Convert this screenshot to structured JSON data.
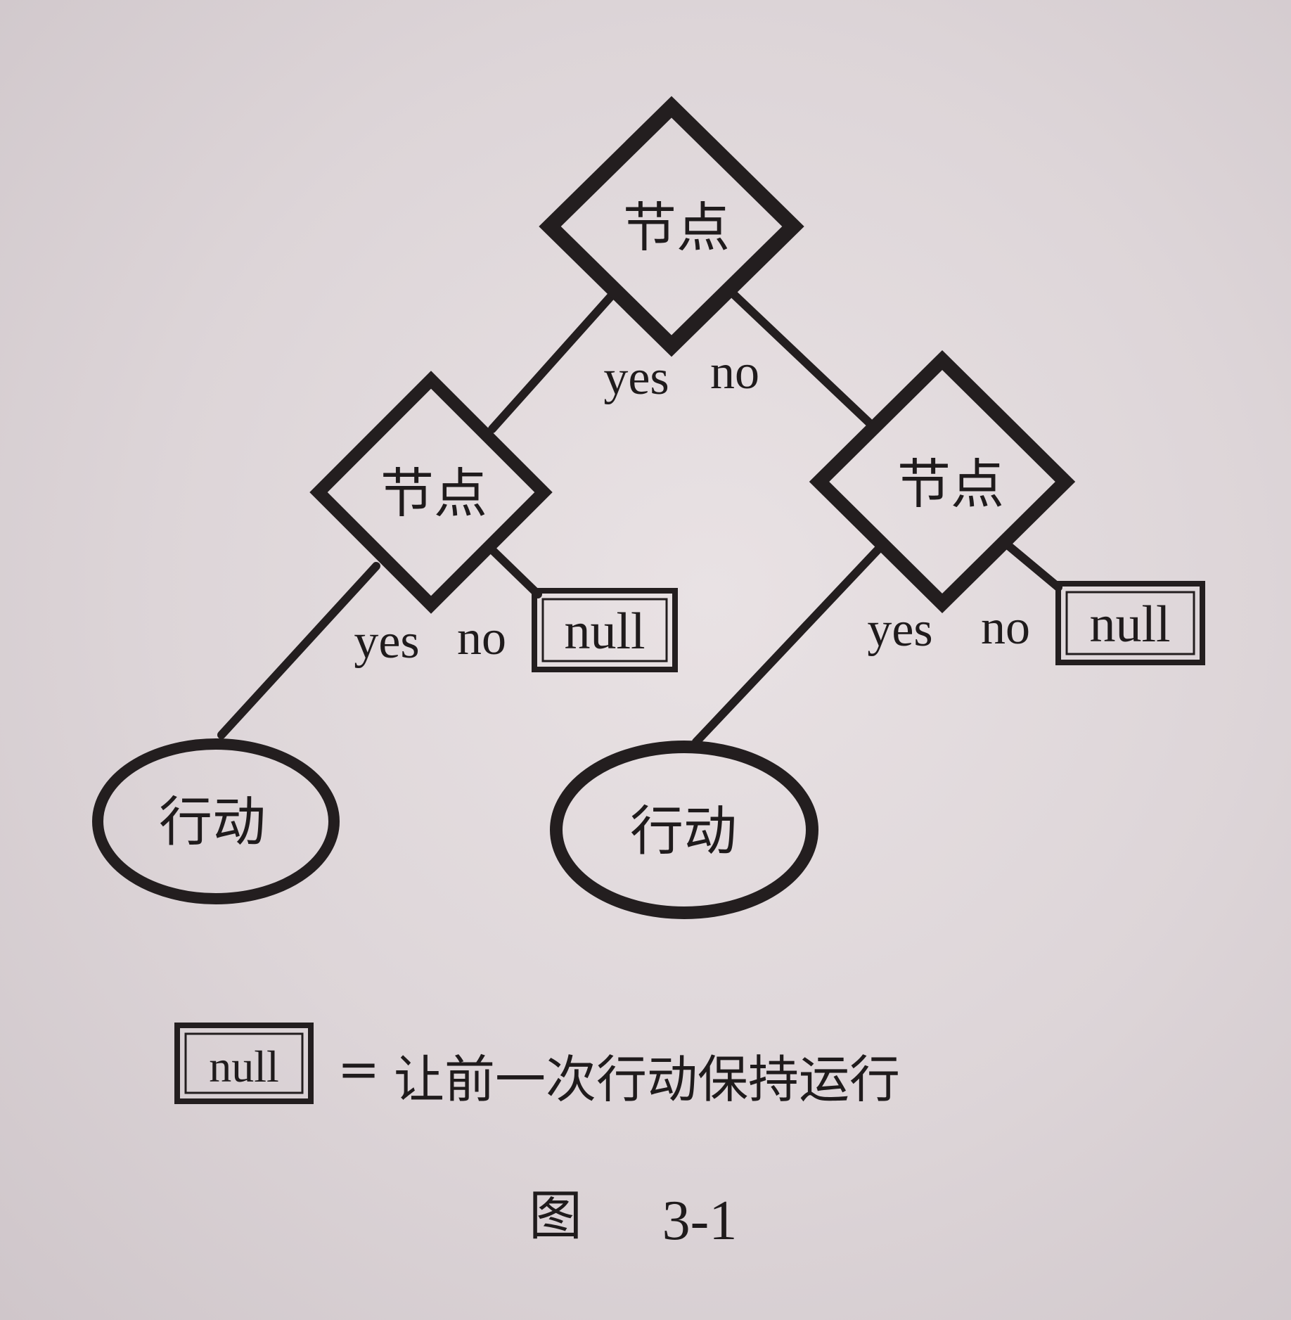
{
  "diagram": {
    "root_node": {
      "label": "节点",
      "yes_label": "yes",
      "no_label": "no"
    },
    "left_node": {
      "label": "节点",
      "yes_label": "yes",
      "no_label": "no",
      "null_label": "null"
    },
    "right_node": {
      "label": "节点",
      "yes_label": "yes",
      "no_label": "no",
      "null_label": "null"
    },
    "left_action": {
      "label": "行动"
    },
    "right_action": {
      "label": "行动"
    }
  },
  "legend": {
    "null_label": "null",
    "equals": "=",
    "description": "让前一次行动保持运行"
  },
  "caption": {
    "prefix": "图",
    "number": "3-1"
  }
}
